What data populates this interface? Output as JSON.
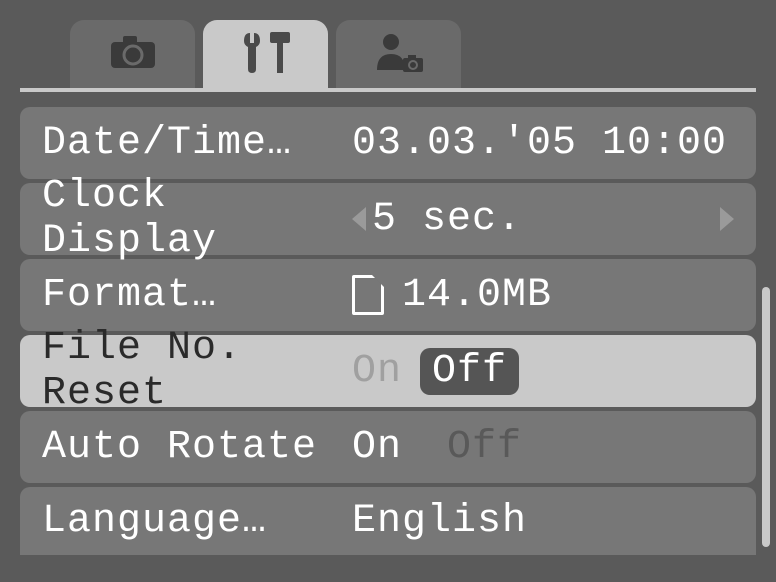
{
  "tabs": {
    "camera": "camera-icon",
    "setup": "tools-icon",
    "user": "person-camera-icon"
  },
  "menu": {
    "items": [
      {
        "label": "Date/Time…",
        "value": "03.03.'05 10:00"
      },
      {
        "label": "Clock Display",
        "value": "5 sec."
      },
      {
        "label": "Format…",
        "value": "14.0MB"
      },
      {
        "label": "File No. Reset",
        "on": "On",
        "off": "Off"
      },
      {
        "label": "Auto Rotate",
        "on": "On",
        "off": "Off"
      },
      {
        "label": "Language…",
        "value": "English"
      }
    ]
  }
}
